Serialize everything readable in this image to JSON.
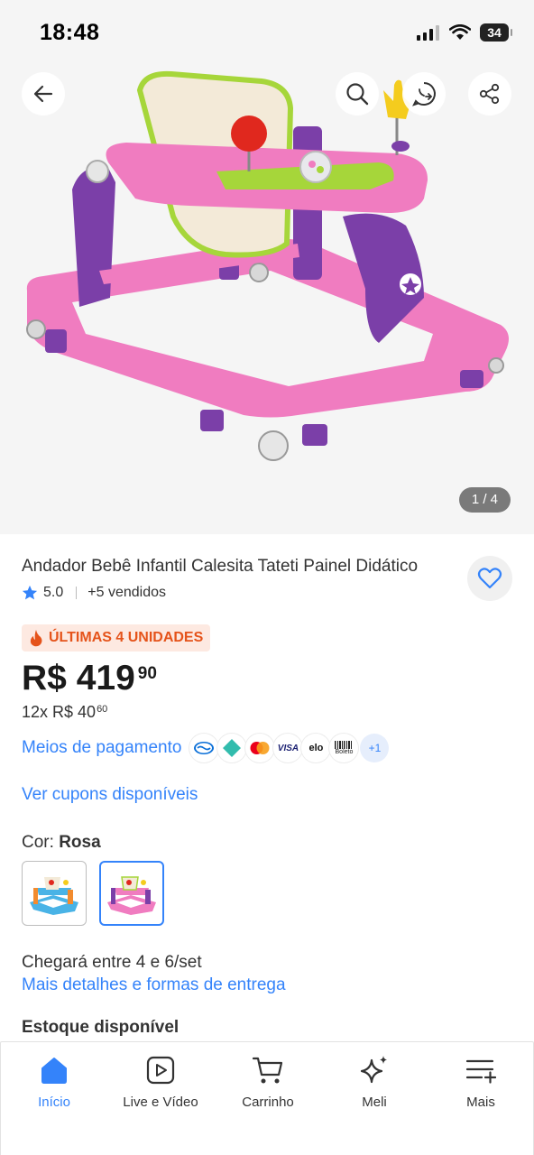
{
  "status_bar": {
    "time": "18:48",
    "battery": "34"
  },
  "gallery": {
    "counter": "1 / 4",
    "current_image": 1,
    "total_images": 4
  },
  "product": {
    "title": "Andador Bebê Infantil Calesita Tateti Painel Didático",
    "rating": "5.0",
    "sold": "+5 vendidos",
    "urgency": "ÚLTIMAS 4 UNIDADES",
    "price_main": "R$ 419",
    "price_cents": "90",
    "installments_main": "12x R$ 40",
    "installments_cents": "60",
    "payment_link": "Meios de pagamento",
    "payment_more": "+1",
    "coupons_link": "Ver cupons disponíveis",
    "color_label": "Cor: ",
    "color_value": "Rosa",
    "delivery_text": "Chegará entre 4 e 6/set",
    "delivery_link": "Mais detalhes e formas de entrega",
    "stock_title": "Estoque disponível"
  },
  "payment_icons": [
    "mercado-pago-icon",
    "pix-icon",
    "mastercard-icon",
    "visa-icon",
    "elo-icon",
    "boleto-icon"
  ],
  "payment_text": {
    "visa": "VISA",
    "elo": "elo",
    "boleto": "Boleto"
  },
  "bottom_nav": [
    {
      "label": "Início",
      "icon": "home-icon",
      "active": true
    },
    {
      "label": "Live e Vídeo",
      "icon": "play-icon",
      "active": false
    },
    {
      "label": "Carrinho",
      "icon": "cart-icon",
      "active": false
    },
    {
      "label": "Meli",
      "icon": "sparkle-icon",
      "active": false
    },
    {
      "label": "Mais",
      "icon": "menu-plus-icon",
      "active": false
    }
  ],
  "colors": {
    "accent": "#3483fa",
    "urgency": "#e5531a",
    "urgency_bg": "#fde9e1",
    "product_pink": "#f27cc1",
    "product_purple": "#7b3fa8",
    "product_green": "#a6d63a"
  }
}
